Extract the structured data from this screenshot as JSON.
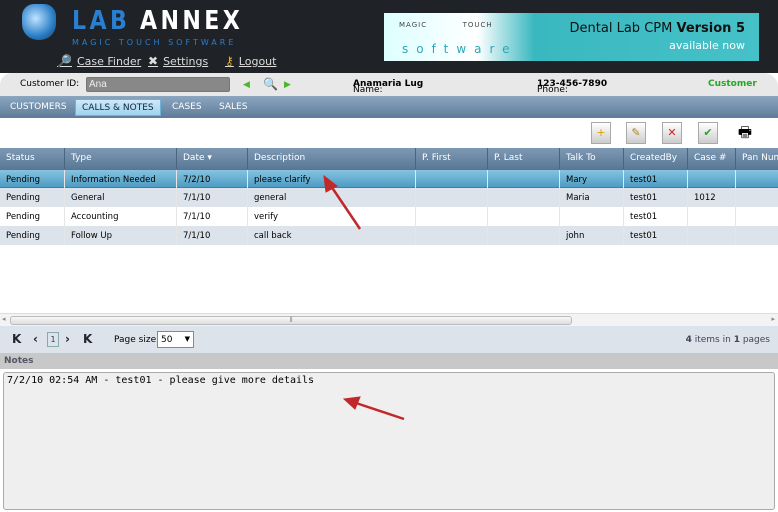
{
  "header": {
    "logo": {
      "lab": "LAB",
      "annex": "ANNEX",
      "subtitle": "MAGIC TOUCH SOFTWARE"
    },
    "links": [
      {
        "label": "Case Finder",
        "icon": "magnifier-icon"
      },
      {
        "label": "Settings",
        "icon": "tools-icon"
      },
      {
        "label": "Logout",
        "icon": "key-icon"
      }
    ],
    "banner": {
      "brand_left": "MAGIC",
      "brand_right": "TOUCH",
      "brand_bottom": "software",
      "title": "Dental Lab CPM",
      "title_bold": "Version 5",
      "subtitle": "available now"
    }
  },
  "customer_bar": {
    "id_label": "Customer ID:",
    "id_value": "Ana",
    "name_label": "Name:",
    "name_value": "Anamaria Lug",
    "phone_label": "Phone:",
    "phone_value": "123-456-7890",
    "type": "Customer"
  },
  "tabs": [
    {
      "label": "CUSTOMERS"
    },
    {
      "label": "CALLS & NOTES",
      "active": true
    },
    {
      "label": "CASES"
    },
    {
      "label": "SALES"
    }
  ],
  "toolbar": [
    "add-note-icon",
    "edit-note-icon",
    "delete-note-icon",
    "complete-note-icon",
    "print-icon"
  ],
  "grid": {
    "columns": [
      "Status",
      "Type",
      "Date ▾",
      "Description",
      "P. First",
      "P. Last",
      "Talk To",
      "CreatedBy",
      "Case #",
      "Pan Num"
    ],
    "rows": [
      [
        "Pending",
        "Information Needed",
        "7/2/10",
        "please clarify",
        "",
        "",
        "Mary",
        "test01",
        "",
        ""
      ],
      [
        "Pending",
        "General",
        "7/1/10",
        "general",
        "",
        "",
        "Maria",
        "test01",
        "1012",
        ""
      ],
      [
        "Pending",
        "Accounting",
        "7/1/10",
        "verify",
        "",
        "",
        "",
        "test01",
        "",
        ""
      ],
      [
        "Pending",
        "Follow Up",
        "7/1/10",
        "call back",
        "",
        "",
        "john",
        "test01",
        "",
        ""
      ]
    ]
  },
  "pager": {
    "page": "1",
    "page_size_label": "Page size:",
    "page_size": "50",
    "items": "4",
    "items_mid": "items in",
    "pages": "1",
    "pages_suffix": "pages"
  },
  "notes": {
    "label": "Notes",
    "text": "7/2/10 02:54 AM - test01 - please give more details"
  },
  "colors": {
    "header_bg": "#1f2226",
    "selected_row": "#5ea9cf",
    "customer_green": "#22aa22",
    "annotation_arrow": "#c0282a"
  }
}
